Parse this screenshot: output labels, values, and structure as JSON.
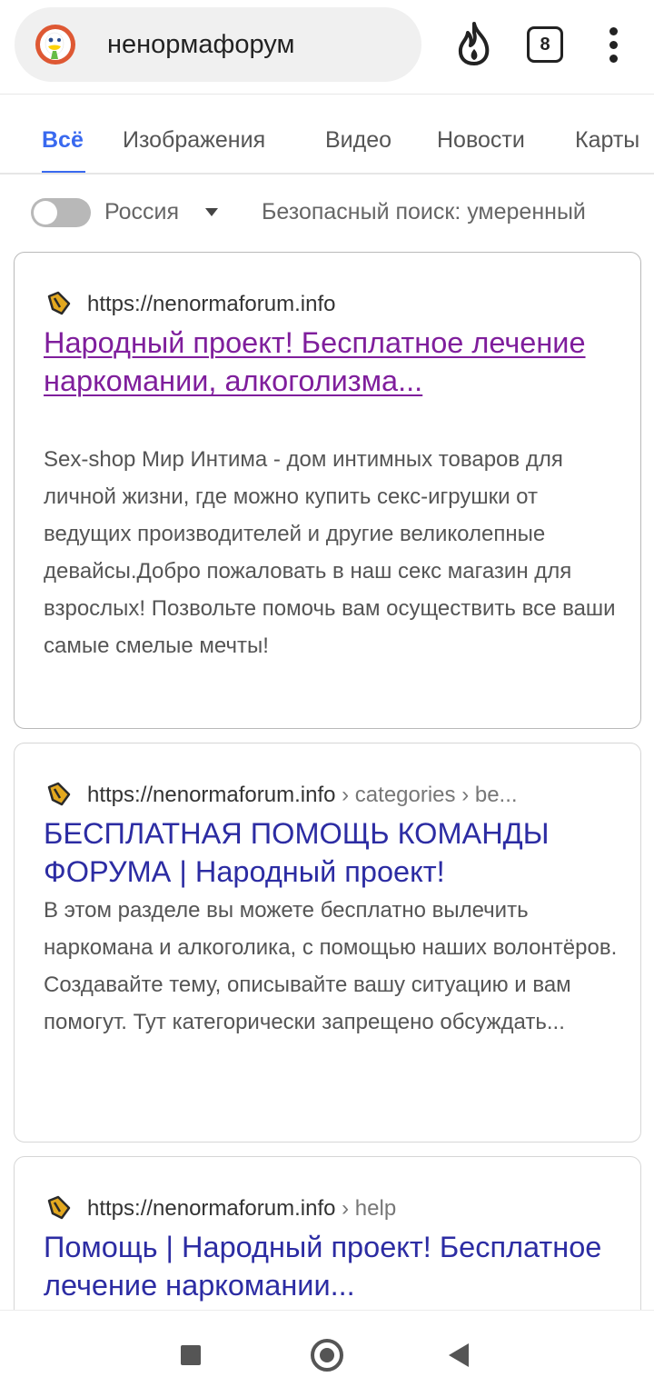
{
  "search": {
    "query": "ненормафорум",
    "tabs_count": "8"
  },
  "nav_tabs": [
    {
      "label": "Всё",
      "active": true
    },
    {
      "label": "Изображения"
    },
    {
      "label": "Видео"
    },
    {
      "label": "Новости"
    },
    {
      "label": "Карты"
    }
  ],
  "filters": {
    "region": "Россия",
    "safe_search": "Безопасный поиск: умеренный"
  },
  "results": [
    {
      "url": "https://nenormaforum.info",
      "crumbs": "",
      "title": "Народный проект! Бесплатное лечение наркомании, алкоголизма...",
      "snippet": "Sex-shop Мир Интима - дом интимных товаров для личной жизни, где можно купить секс-игрушки от ведущих производителей и другие великолепные девайсы.Добро пожаловать в наш секс магазин для взрослых! Позвольте помочь вам осуществить все ваши самые смелые мечты!"
    },
    {
      "url": "https://nenormaforum.info",
      "crumbs": " › categories › be...",
      "title": "БЕСПЛАТНАЯ ПОМОЩЬ КОМАНДЫ ФОРУМА | Народный проект!",
      "snippet": "В этом разделе вы можете бесплатно вылечить наркомана и алкоголика, с помощью наших волонтёров. Создавайте тему, описывайте вашу ситуацию и вам помогут. Тут категорически запрещено обсуждать..."
    },
    {
      "url": "https://nenormaforum.info",
      "crumbs": " › help",
      "title": "Помощь | Народный проект! Бесплатное лечение наркомании...",
      "snippet": ""
    }
  ],
  "colors": {
    "accent": "#3969ef",
    "link": "#2c2ca3",
    "visited_link": "#7f1e9c"
  },
  "icons": {
    "logo": "duckduckgo-logo",
    "fire": "fire-icon",
    "tabs": "tabs-icon",
    "menu": "more-vert-icon",
    "favicon": "site-favicon",
    "system_nav": [
      "recents-square-icon",
      "home-circle-icon",
      "back-triangle-icon"
    ]
  }
}
